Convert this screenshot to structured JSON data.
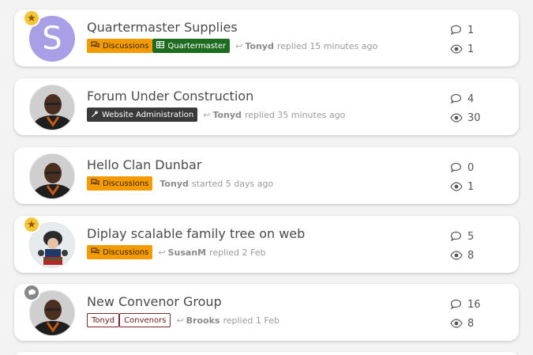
{
  "topics": [
    {
      "title": "Quartermaster Supplies",
      "avatar_letter": "S",
      "badge": "star",
      "tags": [
        {
          "label": "Discussions",
          "style": "orange",
          "icon": "comments-icon"
        },
        {
          "label": "Quartermaster",
          "style": "green",
          "icon": "table-icon"
        }
      ],
      "user": "Tonyd",
      "action": "replied 15 minutes ago",
      "replies": "1",
      "views": "1"
    },
    {
      "title": "Forum Under Construction",
      "badge": "",
      "tags": [
        {
          "label": "Website Administration",
          "style": "dark",
          "icon": "wrench-icon"
        }
      ],
      "user": "Tonyd",
      "action": "replied 35 minutes ago",
      "replies": "4",
      "views": "30"
    },
    {
      "title": "Hello Clan Dunbar",
      "badge": "",
      "tags": [
        {
          "label": "Discussions",
          "style": "orange",
          "icon": "comments-icon"
        }
      ],
      "user": "Tonyd",
      "action": "started 5 days ago",
      "replies": "0",
      "views": "1"
    },
    {
      "title": "Diplay scalable family tree on web",
      "badge": "star",
      "tags": [
        {
          "label": "Discussions",
          "style": "orange",
          "icon": "comments-icon"
        }
      ],
      "user": "SusanM",
      "action": "replied 2 Feb",
      "replies": "5",
      "views": "8"
    },
    {
      "title": "New Convenor Group",
      "badge": "chat",
      "tags": [
        {
          "label": "Tonyd",
          "style": "outline",
          "icon": ""
        },
        {
          "label": "Convenors",
          "style": "outline",
          "icon": ""
        }
      ],
      "user": "Brooks",
      "action": "replied 1 Feb",
      "replies": "16",
      "views": "8"
    }
  ],
  "colors": {
    "orange_tag": "#f39b00",
    "green_tag": "#1c6b1f",
    "dark_tag": "#3a3a3a",
    "star_badge": "#f6c53a",
    "letter_avatar": "#a99fe6"
  }
}
